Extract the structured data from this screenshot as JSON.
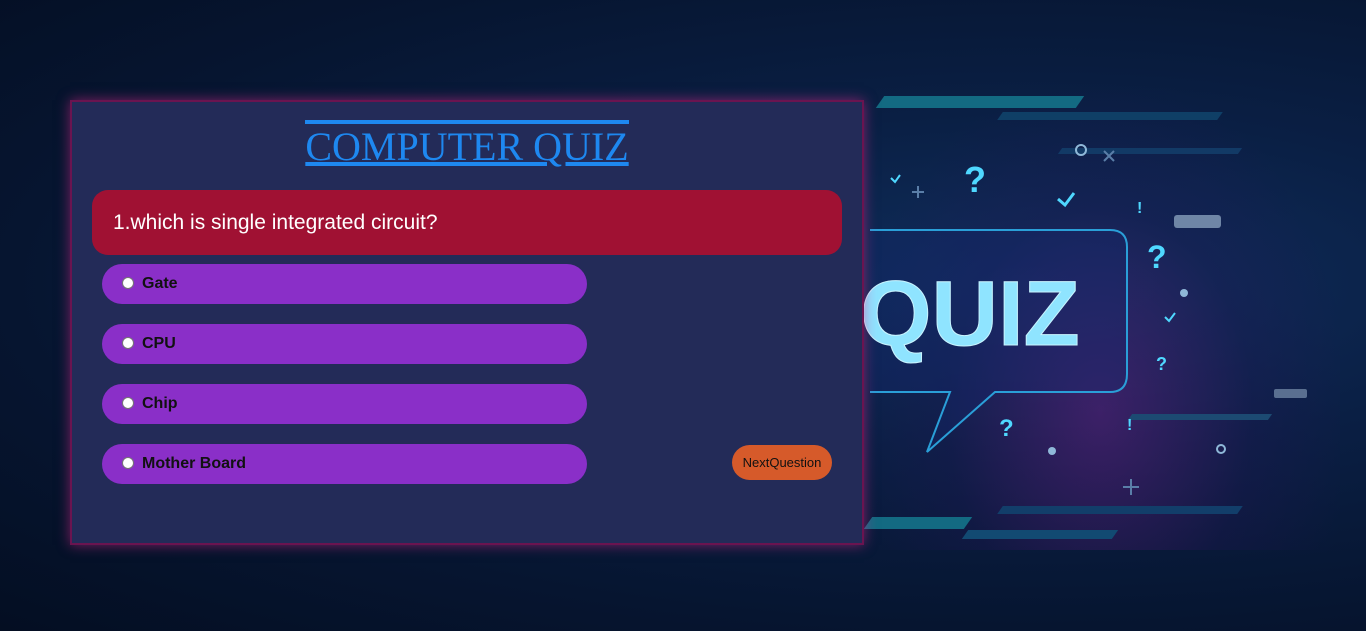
{
  "quiz": {
    "title": "COMPUTER QUIZ",
    "question": "1.which is single integrated circuit?",
    "options": [
      {
        "label": "Gate"
      },
      {
        "label": "CPU"
      },
      {
        "label": "Chip"
      },
      {
        "label": "Mother Board"
      }
    ],
    "next_label": "NextQuestion"
  },
  "background_art": {
    "word": "QUIZ",
    "symbols": [
      "?",
      "?",
      "?",
      "?",
      "!",
      "!"
    ]
  },
  "colors": {
    "card": "#232b58",
    "question_bg": "#a01133",
    "option_bg": "#8a2fc8",
    "button_bg": "#d65a2a",
    "title": "#1e88f0",
    "neon": "#8fe4ff"
  }
}
